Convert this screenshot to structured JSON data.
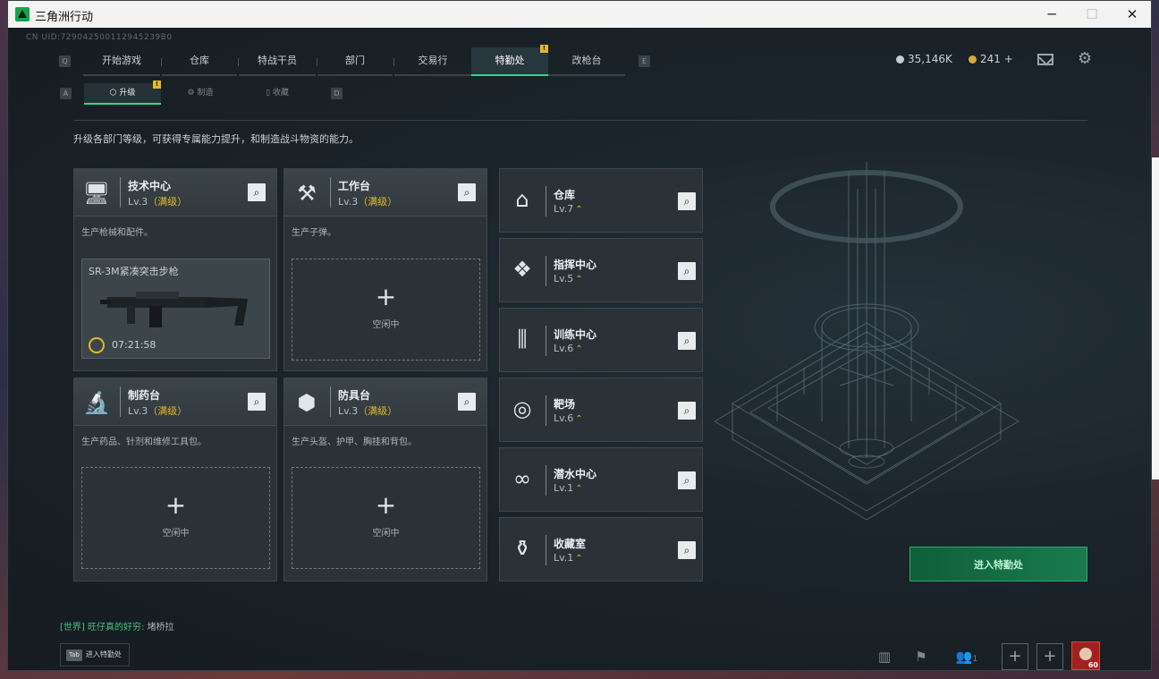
{
  "window": {
    "title": "三角洲行动",
    "minimize": "─",
    "maximize": "☐",
    "close": "✕"
  },
  "uid": "CN UID:729042500112945239B0",
  "nav": {
    "left_key": "Q",
    "right_key": "E",
    "tabs": [
      "开始游戏",
      "仓库",
      "特战干员",
      "部门",
      "交易行",
      "特勤处",
      "改枪台"
    ],
    "active_badge": "!"
  },
  "currency": {
    "coins": "35,146K",
    "premium": "241",
    "add": "+"
  },
  "subnav": {
    "left_key": "A",
    "right_key": "D",
    "tabs": [
      "升级",
      "制造",
      "收藏"
    ],
    "active_badge": "!"
  },
  "description": "升级各部门等级，可获得专属能力提升，和制造战斗物资的能力。",
  "big_cards": [
    {
      "name": "技术中心",
      "level": "Lv.3",
      "max": "（满级）",
      "desc": "生产枪械和配件。",
      "icon": "monitor-icon"
    },
    {
      "name": "工作台",
      "level": "Lv.3",
      "max": "（满级）",
      "desc": "生产子弹。",
      "icon": "tools-icon"
    },
    {
      "name": "制药台",
      "level": "Lv.3",
      "max": "（满级）",
      "desc": "生产药品、针剂和维修工具包。",
      "icon": "microscope-icon"
    },
    {
      "name": "防具台",
      "level": "Lv.3",
      "max": "（满级）",
      "desc": "生产头盔、护甲、胸挂和背包。",
      "icon": "cubes-icon"
    }
  ],
  "production": {
    "item": "SR-3M紧凑突击步枪",
    "timer": "07:21:58"
  },
  "slot": {
    "plus": "+",
    "idle": "空闲中"
  },
  "small_cards": [
    {
      "name": "仓库",
      "level": "Lv.7",
      "icon": "warehouse-icon"
    },
    {
      "name": "指挥中心",
      "level": "Lv.5",
      "icon": "command-icon"
    },
    {
      "name": "训练中心",
      "level": "Lv.6",
      "icon": "dumbbell-icon"
    },
    {
      "name": "靶场",
      "level": "Lv.6",
      "icon": "target-icon"
    },
    {
      "name": "潜水中心",
      "level": "Lv.1",
      "icon": "goggles-icon"
    },
    {
      "name": "收藏室",
      "level": "Lv.1",
      "icon": "collection-icon"
    }
  ],
  "upgrade_mark": "⌃",
  "enter_button": "进入特勤处",
  "chat": {
    "channel": "[世界]",
    "sender": "旺仔真的好穷:",
    "message": "堵桥拉"
  },
  "tab_hint": {
    "key": "Tab",
    "label": "进入特勤处"
  },
  "bottom": {
    "friends_count": "1",
    "avatar_level": "60"
  },
  "colors": {
    "accent": "#2ad98b",
    "max_level": "#e6b72b"
  }
}
